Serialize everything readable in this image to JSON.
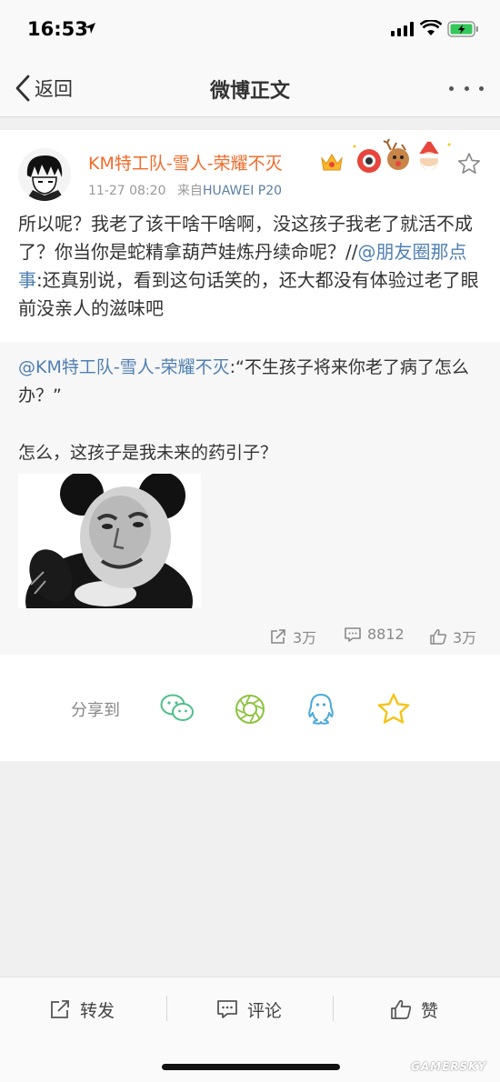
{
  "status_bar": {
    "time": "16:53"
  },
  "nav": {
    "back_label": "返回",
    "title": "微博正文"
  },
  "post": {
    "username": "KM特工队-雪人-荣耀不灭",
    "time": "11-27 08:20",
    "source_prefix": "来自",
    "source": "HUAWEI P20",
    "text_part1": "所以呢？我老了该干啥干啥啊，没这孩子我老了就活不成了？你当你是蛇精拿葫芦娃炼丹续命呢？//",
    "text_mention": "@朋友圈那点事",
    "text_part2": ":还真别说，看到这句话笑的，还大都没有体验过老了眼前没亲人的滋味吧"
  },
  "repost": {
    "mention": "@KM特工队-雪人-荣耀不灭",
    "text": ":“不生孩子将来你老了病了怎么办？”",
    "text2": "怎么，这孩子是我未来的药引子？",
    "reposts": "3万",
    "comments": "8812",
    "likes": "3万"
  },
  "share": {
    "label": "分享到"
  },
  "toolbar": {
    "repost_label": "转发",
    "comment_label": "评论",
    "like_label": "赞"
  },
  "watermark": "GAMERSKY",
  "colors": {
    "username": "#f26b2a",
    "mention": "#4f7fb3",
    "wechat": "#4fbf8a",
    "moments": "#8cc43e",
    "qq": "#4aa9d8",
    "favorite": "#f5c318"
  }
}
